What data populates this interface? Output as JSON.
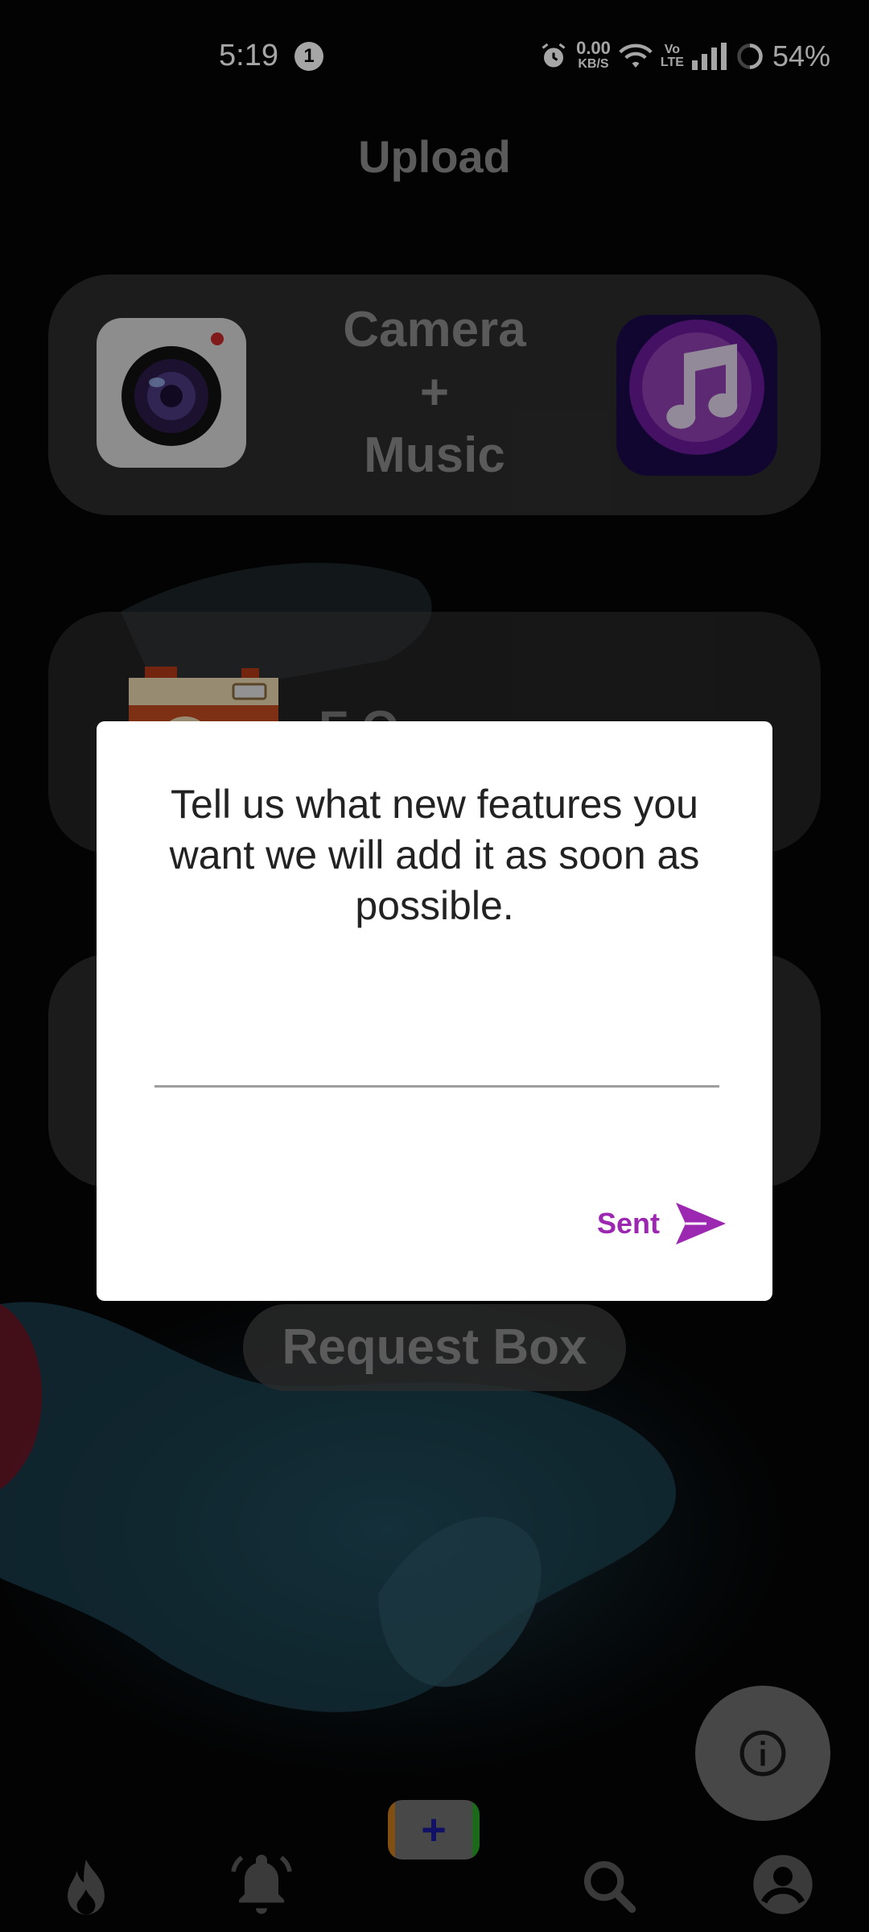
{
  "status_bar": {
    "time": "5:19",
    "notification_count": "1",
    "net_speed_value": "0.00",
    "net_speed_unit": "KB/S",
    "volte_top": "Vo",
    "volte_bottom": "LTE",
    "battery": "54%"
  },
  "header": {
    "title": "Upload"
  },
  "cards": {
    "camera_music": {
      "line1": "Camera",
      "line2": "+",
      "line3": "Music"
    },
    "second_card_partial": "F O"
  },
  "request_box": {
    "label": "Request Box"
  },
  "dialog": {
    "message": "Tell us what new features you want we will add it as soon as possible.",
    "input_value": "",
    "input_placeholder": "",
    "send_label": "Sent"
  },
  "icons": {
    "fab": "info-icon",
    "nav": [
      "fire-icon",
      "bell-icon",
      "add-icon",
      "search-icon",
      "profile-icon"
    ]
  },
  "colors": {
    "accent": "#9c27b0",
    "dialog_bg": "#ffffff",
    "card_bg": "#373737"
  }
}
